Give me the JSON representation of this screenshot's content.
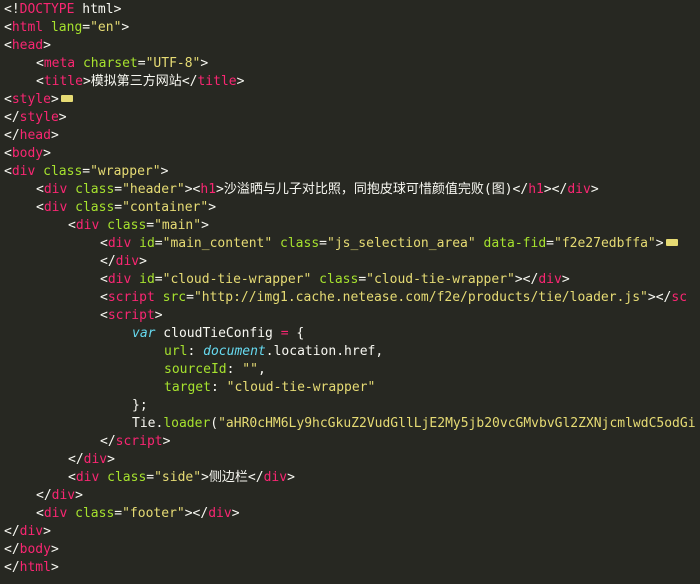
{
  "editor": {
    "lines": [
      {
        "indent": 0,
        "tokens": [
          {
            "t": "punct",
            "v": "<!"
          },
          {
            "t": "tag",
            "v": "DOCTYPE"
          },
          {
            "t": "plain",
            "v": " html"
          },
          {
            "t": "punct",
            "v": ">"
          }
        ]
      },
      {
        "indent": 0,
        "tokens": [
          {
            "t": "punct",
            "v": "<"
          },
          {
            "t": "tag",
            "v": "html"
          },
          {
            "t": "plain",
            "v": " "
          },
          {
            "t": "attr",
            "v": "lang"
          },
          {
            "t": "punct",
            "v": "="
          },
          {
            "t": "str",
            "v": "\"en\""
          },
          {
            "t": "punct",
            "v": ">"
          }
        ]
      },
      {
        "indent": 0,
        "tokens": [
          {
            "t": "punct",
            "v": "<"
          },
          {
            "t": "tag",
            "v": "head"
          },
          {
            "t": "punct",
            "v": ">"
          }
        ]
      },
      {
        "indent": 1,
        "tokens": [
          {
            "t": "punct",
            "v": "<"
          },
          {
            "t": "tag",
            "v": "meta"
          },
          {
            "t": "plain",
            "v": " "
          },
          {
            "t": "attr",
            "v": "charset"
          },
          {
            "t": "punct",
            "v": "="
          },
          {
            "t": "str",
            "v": "\"UTF-8\""
          },
          {
            "t": "punct",
            "v": ">"
          }
        ]
      },
      {
        "indent": 1,
        "tokens": [
          {
            "t": "punct",
            "v": "<"
          },
          {
            "t": "tag",
            "v": "title"
          },
          {
            "t": "punct",
            "v": ">"
          },
          {
            "t": "plain",
            "v": "模拟第三方网站"
          },
          {
            "t": "punct",
            "v": "</"
          },
          {
            "t": "tag",
            "v": "title"
          },
          {
            "t": "punct",
            "v": ">"
          }
        ]
      },
      {
        "indent": 0,
        "tokens": [
          {
            "t": "punct",
            "v": "<"
          },
          {
            "t": "tag",
            "v": "style"
          },
          {
            "t": "punct",
            "v": ">"
          },
          {
            "t": "fold",
            "v": ""
          }
        ]
      },
      {
        "indent": 0,
        "tokens": [
          {
            "t": "punct",
            "v": "</"
          },
          {
            "t": "tag",
            "v": "style"
          },
          {
            "t": "punct",
            "v": ">"
          }
        ]
      },
      {
        "indent": 0,
        "tokens": [
          {
            "t": "punct",
            "v": "</"
          },
          {
            "t": "tag",
            "v": "head"
          },
          {
            "t": "punct",
            "v": ">"
          }
        ]
      },
      {
        "indent": 0,
        "tokens": [
          {
            "t": "punct",
            "v": "<"
          },
          {
            "t": "tag",
            "v": "body"
          },
          {
            "t": "punct",
            "v": ">"
          }
        ]
      },
      {
        "indent": 0,
        "tokens": [
          {
            "t": "punct",
            "v": "<"
          },
          {
            "t": "tag",
            "v": "div"
          },
          {
            "t": "plain",
            "v": " "
          },
          {
            "t": "attr",
            "v": "class"
          },
          {
            "t": "punct",
            "v": "="
          },
          {
            "t": "str",
            "v": "\"wrapper\""
          },
          {
            "t": "punct",
            "v": ">"
          }
        ]
      },
      {
        "indent": 1,
        "tokens": [
          {
            "t": "punct",
            "v": "<"
          },
          {
            "t": "tag",
            "v": "div"
          },
          {
            "t": "plain",
            "v": " "
          },
          {
            "t": "attr",
            "v": "class"
          },
          {
            "t": "punct",
            "v": "="
          },
          {
            "t": "str",
            "v": "\"header\""
          },
          {
            "t": "punct",
            "v": "><"
          },
          {
            "t": "tag",
            "v": "h1"
          },
          {
            "t": "punct",
            "v": ">"
          },
          {
            "t": "plain",
            "v": "沙溢晒与儿子对比照，同抱皮球可惜颜值完败(图)"
          },
          {
            "t": "punct",
            "v": "</"
          },
          {
            "t": "tag",
            "v": "h1"
          },
          {
            "t": "punct",
            "v": "></"
          },
          {
            "t": "tag",
            "v": "div"
          },
          {
            "t": "punct",
            "v": ">"
          }
        ]
      },
      {
        "indent": 1,
        "tokens": [
          {
            "t": "punct",
            "v": "<"
          },
          {
            "t": "tag",
            "v": "div"
          },
          {
            "t": "plain",
            "v": " "
          },
          {
            "t": "attr",
            "v": "class"
          },
          {
            "t": "punct",
            "v": "="
          },
          {
            "t": "str",
            "v": "\"container\""
          },
          {
            "t": "punct",
            "v": ">"
          }
        ]
      },
      {
        "indent": 2,
        "tokens": [
          {
            "t": "punct",
            "v": "<"
          },
          {
            "t": "tag",
            "v": "div"
          },
          {
            "t": "plain",
            "v": " "
          },
          {
            "t": "attr",
            "v": "class"
          },
          {
            "t": "punct",
            "v": "="
          },
          {
            "t": "str",
            "v": "\"main\""
          },
          {
            "t": "punct",
            "v": ">"
          }
        ]
      },
      {
        "indent": 3,
        "tokens": [
          {
            "t": "punct",
            "v": "<"
          },
          {
            "t": "tag",
            "v": "div"
          },
          {
            "t": "plain",
            "v": " "
          },
          {
            "t": "attr",
            "v": "id"
          },
          {
            "t": "punct",
            "v": "="
          },
          {
            "t": "str",
            "v": "\"main_content\""
          },
          {
            "t": "plain",
            "v": " "
          },
          {
            "t": "attr",
            "v": "class"
          },
          {
            "t": "punct",
            "v": "="
          },
          {
            "t": "str",
            "v": "\"js_selection_area\""
          },
          {
            "t": "plain",
            "v": " "
          },
          {
            "t": "attr",
            "v": "data-fid"
          },
          {
            "t": "punct",
            "v": "="
          },
          {
            "t": "str",
            "v": "\"f2e27edbffa\""
          },
          {
            "t": "punct",
            "v": ">"
          },
          {
            "t": "fold",
            "v": ""
          }
        ]
      },
      {
        "indent": 3,
        "tokens": [
          {
            "t": "punct",
            "v": "</"
          },
          {
            "t": "tag",
            "v": "div"
          },
          {
            "t": "punct",
            "v": ">"
          }
        ]
      },
      {
        "indent": 3,
        "tokens": [
          {
            "t": "punct",
            "v": "<"
          },
          {
            "t": "tag",
            "v": "div"
          },
          {
            "t": "plain",
            "v": " "
          },
          {
            "t": "attr",
            "v": "id"
          },
          {
            "t": "punct",
            "v": "="
          },
          {
            "t": "str",
            "v": "\"cloud-tie-wrapper\""
          },
          {
            "t": "plain",
            "v": " "
          },
          {
            "t": "attr",
            "v": "class"
          },
          {
            "t": "punct",
            "v": "="
          },
          {
            "t": "str",
            "v": "\"cloud-tie-wrapper\""
          },
          {
            "t": "punct",
            "v": "></"
          },
          {
            "t": "tag",
            "v": "div"
          },
          {
            "t": "punct",
            "v": ">"
          }
        ]
      },
      {
        "indent": 3,
        "tokens": [
          {
            "t": "punct",
            "v": "<"
          },
          {
            "t": "tag",
            "v": "script"
          },
          {
            "t": "plain",
            "v": " "
          },
          {
            "t": "attr",
            "v": "src"
          },
          {
            "t": "punct",
            "v": "="
          },
          {
            "t": "str",
            "v": "\"http://img1.cache.netease.com/f2e/products/tie/loader.js\""
          },
          {
            "t": "punct",
            "v": "></"
          },
          {
            "t": "tag",
            "v": "sc"
          }
        ]
      },
      {
        "indent": 3,
        "tokens": [
          {
            "t": "punct",
            "v": "<"
          },
          {
            "t": "tag",
            "v": "script"
          },
          {
            "t": "punct",
            "v": ">"
          }
        ]
      },
      {
        "indent": 4,
        "tokens": [
          {
            "t": "kw",
            "v": "var"
          },
          {
            "t": "plain",
            "v": " cloudTieConfig "
          },
          {
            "t": "op",
            "v": "="
          },
          {
            "t": "plain",
            "v": " {"
          }
        ]
      },
      {
        "indent": 5,
        "tokens": [
          {
            "t": "attr",
            "v": "url"
          },
          {
            "t": "plain",
            "v": ": "
          },
          {
            "t": "kw",
            "v": "document"
          },
          {
            "t": "plain",
            "v": "."
          },
          {
            "t": "prop",
            "v": "location"
          },
          {
            "t": "plain",
            "v": "."
          },
          {
            "t": "prop",
            "v": "href"
          },
          {
            "t": "plain",
            "v": ","
          }
        ]
      },
      {
        "indent": 5,
        "tokens": [
          {
            "t": "attr",
            "v": "sourceId"
          },
          {
            "t": "plain",
            "v": ": "
          },
          {
            "t": "str",
            "v": "\"\""
          },
          {
            "t": "plain",
            "v": ","
          }
        ]
      },
      {
        "indent": 5,
        "tokens": [
          {
            "t": "attr",
            "v": "target"
          },
          {
            "t": "plain",
            "v": ": "
          },
          {
            "t": "str",
            "v": "\"cloud-tie-wrapper\""
          }
        ]
      },
      {
        "indent": 4,
        "tokens": [
          {
            "t": "plain",
            "v": "};"
          }
        ]
      },
      {
        "indent": 4,
        "tokens": [
          {
            "t": "plain",
            "v": "Tie."
          },
          {
            "t": "attr",
            "v": "loader"
          },
          {
            "t": "plain",
            "v": "("
          },
          {
            "t": "str",
            "v": "\"aHR0cHM6Ly9hcGkuZ2VudGllLjE2My5jb20vcGMvbvGl2ZXNjcmlwdC5odGi"
          }
        ]
      },
      {
        "indent": 3,
        "tokens": [
          {
            "t": "punct",
            "v": "</"
          },
          {
            "t": "tag",
            "v": "script"
          },
          {
            "t": "punct",
            "v": ">"
          }
        ]
      },
      {
        "indent": 2,
        "tokens": [
          {
            "t": "punct",
            "v": "</"
          },
          {
            "t": "tag",
            "v": "div"
          },
          {
            "t": "punct",
            "v": ">"
          }
        ]
      },
      {
        "indent": 2,
        "tokens": [
          {
            "t": "punct",
            "v": "<"
          },
          {
            "t": "tag",
            "v": "div"
          },
          {
            "t": "plain",
            "v": " "
          },
          {
            "t": "attr",
            "v": "class"
          },
          {
            "t": "punct",
            "v": "="
          },
          {
            "t": "str",
            "v": "\"side\""
          },
          {
            "t": "punct",
            "v": ">"
          },
          {
            "t": "plain",
            "v": "侧边栏"
          },
          {
            "t": "punct",
            "v": "</"
          },
          {
            "t": "tag",
            "v": "div"
          },
          {
            "t": "punct",
            "v": ">"
          }
        ]
      },
      {
        "indent": 1,
        "tokens": [
          {
            "t": "punct",
            "v": "</"
          },
          {
            "t": "tag",
            "v": "div"
          },
          {
            "t": "punct",
            "v": ">"
          }
        ]
      },
      {
        "indent": 1,
        "tokens": [
          {
            "t": "punct",
            "v": "<"
          },
          {
            "t": "tag",
            "v": "div"
          },
          {
            "t": "plain",
            "v": " "
          },
          {
            "t": "attr",
            "v": "class"
          },
          {
            "t": "punct",
            "v": "="
          },
          {
            "t": "str",
            "v": "\"footer\""
          },
          {
            "t": "punct",
            "v": "></"
          },
          {
            "t": "tag",
            "v": "div"
          },
          {
            "t": "punct",
            "v": ">"
          }
        ]
      },
      {
        "indent": 0,
        "tokens": [
          {
            "t": "punct",
            "v": "</"
          },
          {
            "t": "tag",
            "v": "div"
          },
          {
            "t": "punct",
            "v": ">"
          }
        ]
      },
      {
        "indent": 0,
        "tokens": [
          {
            "t": "punct",
            "v": "</"
          },
          {
            "t": "tag",
            "v": "body"
          },
          {
            "t": "punct",
            "v": ">"
          }
        ]
      },
      {
        "indent": 0,
        "tokens": [
          {
            "t": "punct",
            "v": "</"
          },
          {
            "t": "tag",
            "v": "html"
          },
          {
            "t": "punct",
            "v": ">"
          }
        ]
      }
    ]
  }
}
